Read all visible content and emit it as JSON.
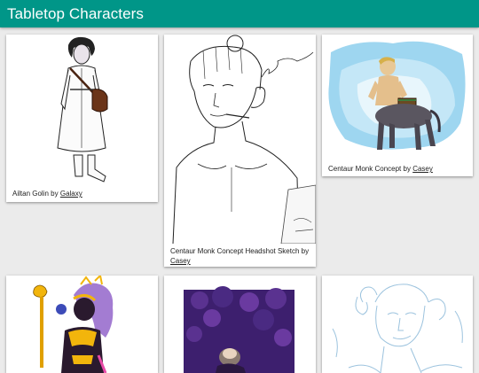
{
  "app": {
    "title": "Tabletop Characters"
  },
  "cards": [
    {
      "title": "Ailtan Golin",
      "by": "by",
      "artist": "Galaxy"
    },
    {
      "title": "Centaur Monk Concept Headshot Sketch",
      "by": "by",
      "artist": "Casey"
    },
    {
      "title": "Centaur Monk Concept",
      "by": "by",
      "artist": "Casey"
    },
    {
      "title": "",
      "by": "",
      "artist": ""
    },
    {
      "title": "",
      "by": "",
      "artist": ""
    },
    {
      "title": "",
      "by": "",
      "artist": ""
    }
  ],
  "colors": {
    "appbar": "#009688",
    "background": "#ebebeb",
    "card": "#ffffff"
  }
}
